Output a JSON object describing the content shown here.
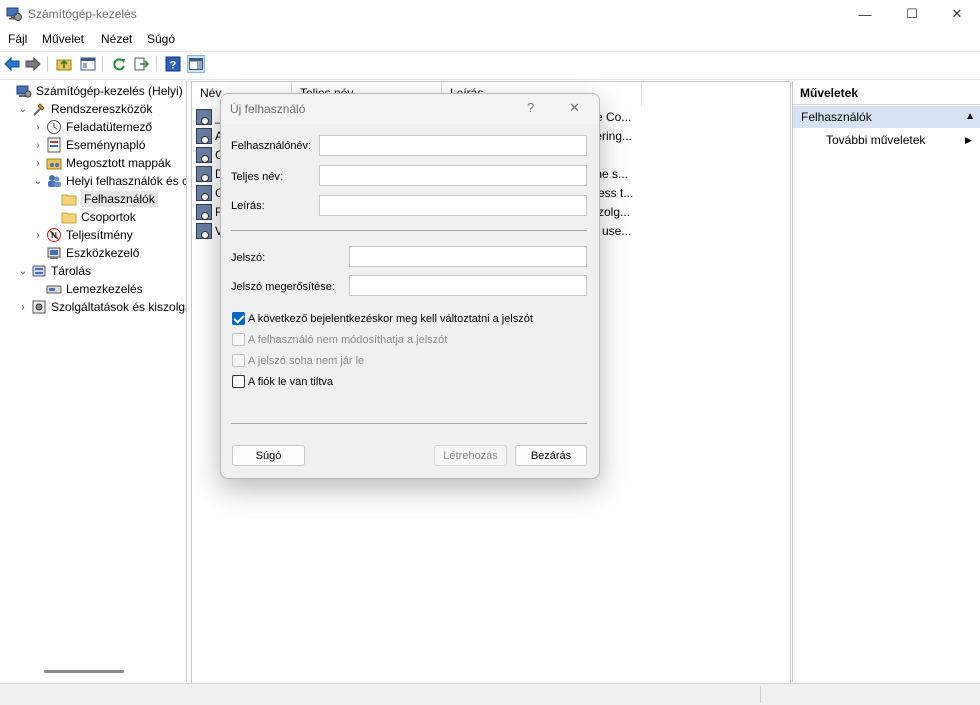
{
  "window": {
    "title": "Számítógép-kezelés",
    "min_glyph": "—",
    "max_glyph": "☐",
    "close_glyph": "✕"
  },
  "menu": [
    "Fájl",
    "Művelet",
    "Nézet",
    "Súgó"
  ],
  "tree": [
    {
      "label": "Számítógép-kezelés (Helyi)",
      "level": 0,
      "exp": "",
      "icon": "computer-management-icon"
    },
    {
      "label": "Rendszereszközök",
      "level": 1,
      "exp": "⌄",
      "icon": "tools-icon"
    },
    {
      "label": "Feladatütemező",
      "level": 2,
      "exp": "›",
      "icon": "clock-icon"
    },
    {
      "label": "Eseménynapló",
      "level": 2,
      "exp": "›",
      "icon": "event-viewer-icon"
    },
    {
      "label": "Megosztott mappák",
      "level": 2,
      "exp": "›",
      "icon": "shared-folder-icon"
    },
    {
      "label": "Helyi felhasználók és cs",
      "level": 2,
      "exp": "⌄",
      "icon": "users-icon"
    },
    {
      "label": "Felhasználók",
      "level": 3,
      "exp": "",
      "icon": "folder-icon",
      "selected": true
    },
    {
      "label": "Csoportok",
      "level": 3,
      "exp": "",
      "icon": "folder-icon"
    },
    {
      "label": "Teljesítmény",
      "level": 2,
      "exp": "›",
      "icon": "performance-icon"
    },
    {
      "label": "Eszközkezelő",
      "level": 2,
      "exp": "",
      "icon": "device-manager-icon"
    },
    {
      "label": "Tárolás",
      "level": 1,
      "exp": "⌄",
      "icon": "storage-icon"
    },
    {
      "label": "Lemezkezelés",
      "level": 2,
      "exp": "",
      "icon": "disk-icon"
    },
    {
      "label": "Szolgáltatások és kiszolgáló",
      "level": 1,
      "exp": "›",
      "icon": "services-icon"
    }
  ],
  "list": {
    "columns": [
      "Név",
      "Teljes név",
      "Leírás"
    ],
    "rows": [
      {
        "name": "_",
        "desc": "re Co..."
      },
      {
        "name": "A",
        "desc": "tering..."
      },
      {
        "name": "C",
        "desc": ""
      },
      {
        "name": "D",
        "desc": "the s..."
      },
      {
        "name": "G",
        "desc": "cess t..."
      },
      {
        "name": "R",
        "desc": "szolg..."
      },
      {
        "name": "V",
        "desc": "d use..."
      }
    ]
  },
  "actions": {
    "header": "Műveletek",
    "section": "Felhasználók",
    "section_arrow": "▲",
    "more": "További műveletek",
    "more_arrow": "▶"
  },
  "dialog": {
    "title": "Új felhasználó",
    "help_glyph": "?",
    "close_glyph": "✕",
    "username_label": "Felhasználónév:",
    "fullname_label": "Teljes név:",
    "description_label": "Leírás:",
    "password_label": "Jelszó:",
    "confirm_label": "Jelszó megerősítése:",
    "username_value": "",
    "fullname_value": "",
    "description_value": "",
    "password_value": "",
    "confirm_value": "",
    "cb_must_change": "A következő bejelentkezéskor meg kell változtatni a jelszót",
    "cb_cannot_change": "A felhasználó nem módosíthatja a jelszót",
    "cb_never_expires": "A jelszó soha nem jár le",
    "cb_disabled": "A fiók le van tiltva",
    "help_button": "Súgó",
    "create_button": "Létrehozás",
    "close_button": "Bezárás"
  }
}
